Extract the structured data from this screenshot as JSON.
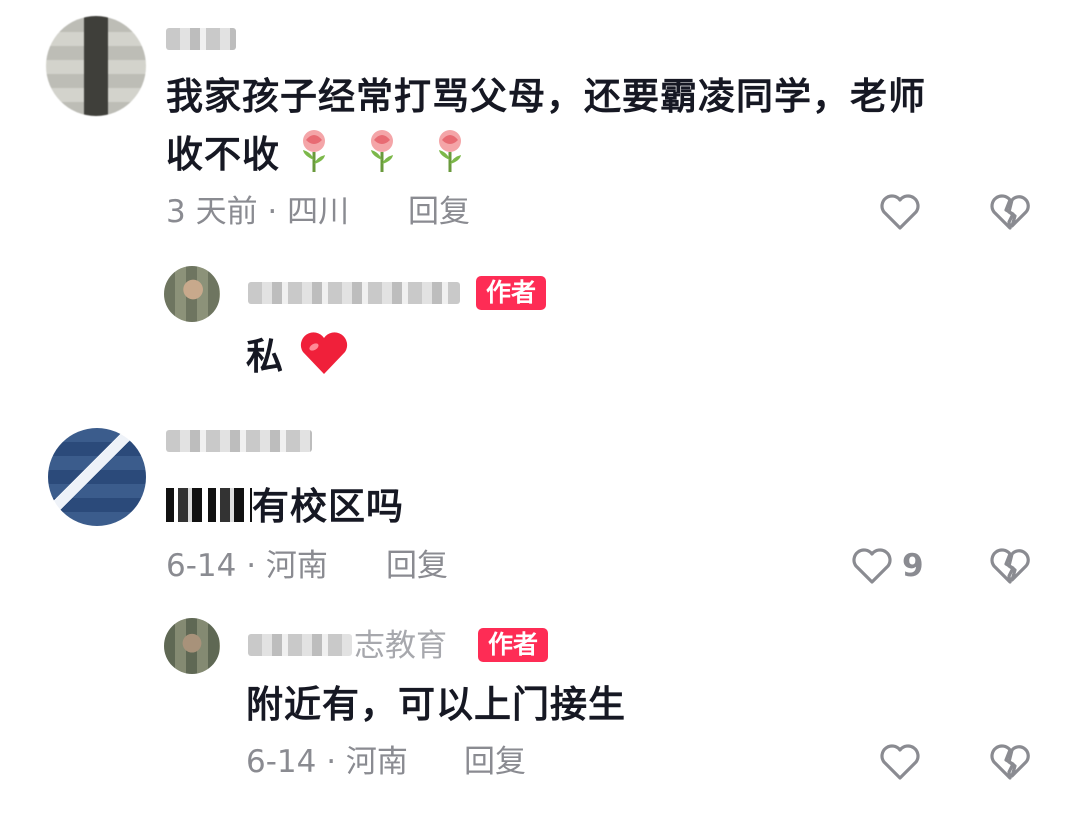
{
  "comments": [
    {
      "text_line1": "我家孩子经常打骂父母，还要霸凌同学，老师",
      "text_line2": "收不收",
      "meta": "3 天前 · 四川",
      "reply_label": "回复",
      "reply": {
        "author_badge": "作者",
        "text": "私"
      }
    },
    {
      "text": "有校区吗",
      "meta": "6-14 · 河南",
      "reply_label": "回复",
      "like_count": "9",
      "reply": {
        "name_suffix": "志教育",
        "author_badge": "作者",
        "text": "附近有，可以上门接生",
        "meta": "6-14 · 河南",
        "reply_label": "回复"
      }
    }
  ],
  "icons": [
    "heart-outline-icon",
    "broken-heart-icon",
    "rose-emoji",
    "red-heart-emoji"
  ],
  "colors": {
    "badge": "#fe2c55",
    "meta": "#8a8b91",
    "text": "#161823"
  }
}
